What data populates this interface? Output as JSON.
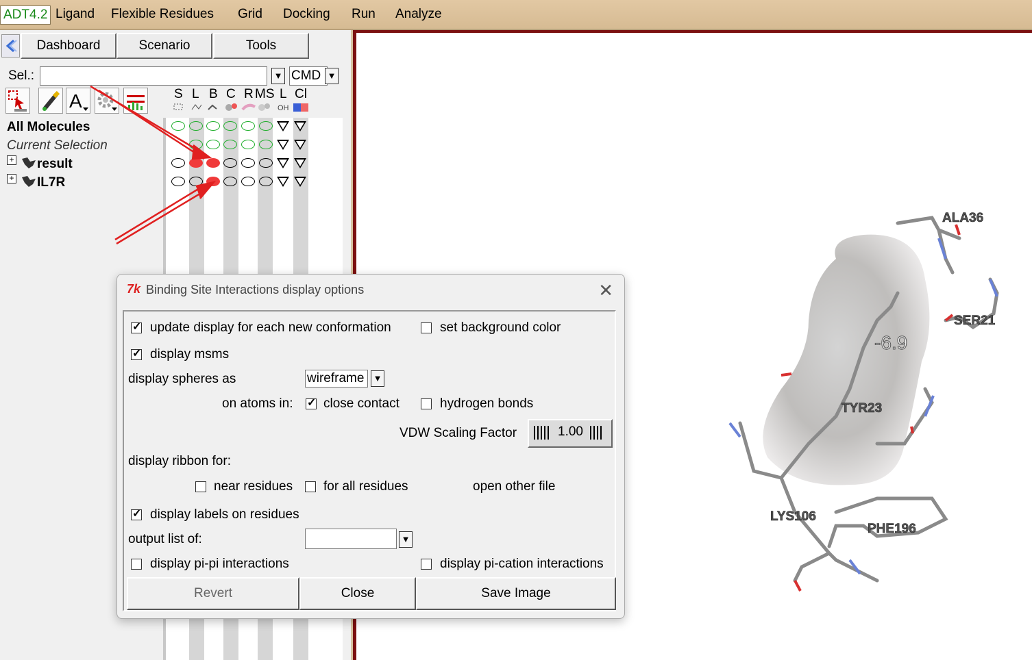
{
  "menubar": {
    "brand": "ADT4.2",
    "items": [
      "Ligand",
      "Flexible Residues",
      "Grid",
      "Docking",
      "Run",
      "Analyze"
    ]
  },
  "tabs": {
    "dashboard": "Dashboard",
    "scenario": "Scenario",
    "tools": "Tools"
  },
  "selection": {
    "label": "Sel.:",
    "value": "",
    "mode": "CMD"
  },
  "columns": [
    "S",
    "L",
    "B",
    "C",
    "R",
    "MS",
    "L",
    "Cl"
  ],
  "column_subicons": {
    "l_col": "OH"
  },
  "tree": {
    "all_molecules": "All Molecules",
    "current_selection": "Current Selection",
    "molecules": [
      "result",
      "IL7R"
    ]
  },
  "dialog": {
    "title": "Binding Site Interactions display options",
    "update_display": "update display for each new conformation",
    "set_bg": "set background color",
    "display_msms": "display msms",
    "display_spheres_as": "display spheres as",
    "spheres_value": "wireframe",
    "on_atoms_in": "on atoms in:",
    "close_contact": "close contact",
    "hydrogen_bonds": "hydrogen bonds",
    "vdw_label": "VDW Scaling Factor",
    "vdw_value": "1.00",
    "display_ribbon_for": "display ribbon for:",
    "near_residues": "near residues",
    "for_all_residues": "for all residues",
    "open_other_file": "open other file",
    "display_labels": "display labels on residues",
    "output_list_of": "output list of:",
    "output_value": "",
    "pi_pi": "display pi-pi interactions",
    "pi_cation": "display pi-cation interactions",
    "revert": "Revert",
    "close": "Close",
    "save_image": "Save Image",
    "checked": {
      "update_display": true,
      "set_bg": false,
      "display_msms": true,
      "close_contact": true,
      "hydrogen_bonds": false,
      "near_residues": false,
      "for_all_residues": false,
      "display_labels": true,
      "pi_pi": false,
      "pi_cation": false
    }
  },
  "viewer": {
    "labels": [
      "ALA36",
      "SER21",
      "TYR23",
      "LYS106",
      "PHE196"
    ],
    "energy": "-6.9"
  },
  "colors": {
    "selected_dot": "#f03a3a",
    "green_ring": "#1fae2b",
    "divider": "#7b1010",
    "annotation_arrow": "#e02020"
  }
}
